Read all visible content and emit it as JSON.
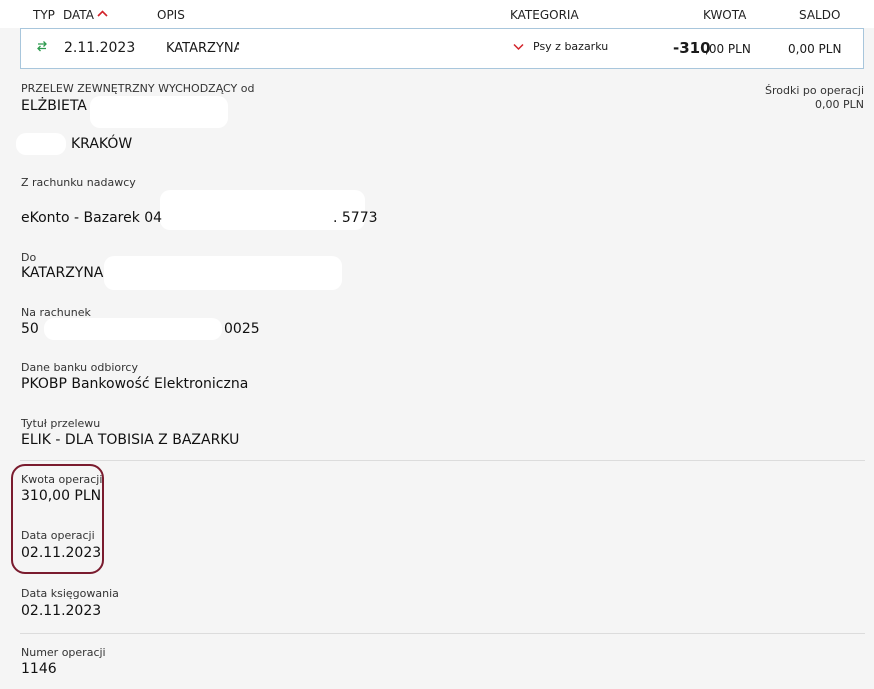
{
  "table_header": {
    "type": "TYP",
    "date": "DATA",
    "description": "OPIS",
    "category": "KATEGORIA",
    "amount": "KWOTA",
    "balance": "SALDO"
  },
  "transaction_row": {
    "date": "2.11.2023",
    "description": "KATARZYNA",
    "category": "Psy z bazarku",
    "amount_main": "-310",
    "amount_decimal": ",00 PLN",
    "balance": "0,00 PLN"
  },
  "details": {
    "transfer_type": "PRZELEW ZEWNĘTRZNY WYCHODZĄCY od",
    "sender_name": "ELŻBIETA",
    "sender_city": "KRAKÓW",
    "balance_after_label": "Środki po operacji",
    "balance_after_value": "0,00 PLN",
    "from_account_label": "Z rachunku nadawcy",
    "from_account_name": "eKonto - Bazarek 04",
    "from_account_suffix": ". 5773",
    "to_label": "Do",
    "to_value": "KATARZYNA",
    "to_account_label": "Na rachunek",
    "to_account_prefix": "50",
    "to_account_suffix": "0025",
    "bank_label": "Dane banku odbiorcy",
    "bank_value": "PKOBP Bankowość Elektroniczna",
    "title_label": "Tytuł przelewu",
    "title_value": "ELIK - DLA TOBISIA Z BAZARKU",
    "amount_label": "Kwota operacji",
    "amount_value": "310,00 PLN",
    "op_date_label": "Data operacji",
    "op_date_value": "02.11.2023",
    "booking_date_label": "Data księgowania",
    "booking_date_value": "02.11.2023",
    "op_number_label": "Numer operacji",
    "op_number_value": "1146"
  },
  "colors": {
    "transfer_icon": "#2e9b4f",
    "sort_arrow": "#d2232a",
    "highlight_border": "#7a1b2e",
    "row_border": "#a8c6dc"
  },
  "icons": {
    "type": "transfer-arrows-icon",
    "sort": "sort-ascending-icon",
    "category": "chevron-down-icon"
  }
}
